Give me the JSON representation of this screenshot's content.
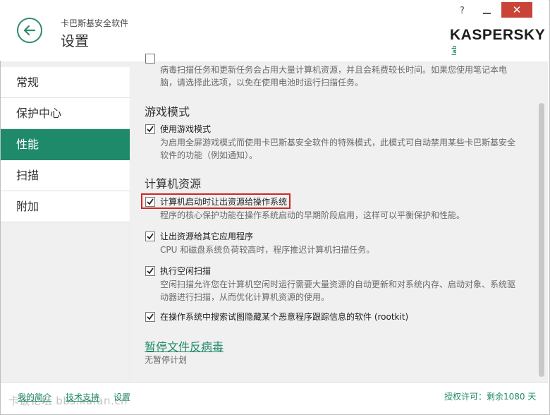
{
  "header": {
    "app_name": "卡巴斯基安全软件",
    "page_title": "设置",
    "help": "?",
    "close": "✕",
    "logo": "KASPERSKY",
    "logo_lab": "lab"
  },
  "sidebar": {
    "items": [
      {
        "label": "常规"
      },
      {
        "label": "保护中心"
      },
      {
        "label": "性能",
        "active": true
      },
      {
        "label": "扫描"
      },
      {
        "label": "附加"
      }
    ]
  },
  "main": {
    "top_desc": "病毒扫描任务和更新任务会占用大量计算机资源，并且会耗费较长时间。如果您使用笔记本电脑，请选择此选项，以免在使用电池时运行扫描任务。",
    "game_section": {
      "title": "游戏模式",
      "option_label": "使用游戏模式",
      "option_desc": "为启用全屏游戏模式而使用卡巴斯基安全软件的特殊模式，此模式可自动禁用某些卡巴斯基安全软件的功能（例如通知）。"
    },
    "resource_section": {
      "title": "计算机资源",
      "options": [
        {
          "label": "计算机启动时让出资源给操作系统",
          "desc": "程序的核心保护功能在操作系统启动的早期阶段启用，这样可以平衡保护和性能。",
          "checked": true
        },
        {
          "label": "让出资源给其它应用程序",
          "desc": "CPU 和磁盘系统负荷较高时，程序推迟计算机扫描任务。",
          "checked": true
        },
        {
          "label": "执行空闲扫描",
          "desc": "空闲扫描允许您在计算机空闲时运行需要大量资源的自动更新和对系统内存、启动对象、系统驱动器进行扫描，从而优化计算机资源的使用。",
          "checked": true
        },
        {
          "label": "在操作系统中搜索试图隐藏某个恶意程序跟踪信息的软件 (rootkit)",
          "desc": "",
          "checked": true
        }
      ]
    },
    "pause_link": "暂停文件反病毒",
    "pause_note": "无暂停计划"
  },
  "footer": {
    "my_profile": "我的简介",
    "support": "技术支持",
    "settings": "设置",
    "license": "授权许可：剩余1080 天",
    "watermark": "卡饭论坛 bbs.kafan.cn"
  },
  "colors": {
    "accent": "#1f8a6a",
    "close": "#c94437",
    "highlight": "#d22525"
  }
}
